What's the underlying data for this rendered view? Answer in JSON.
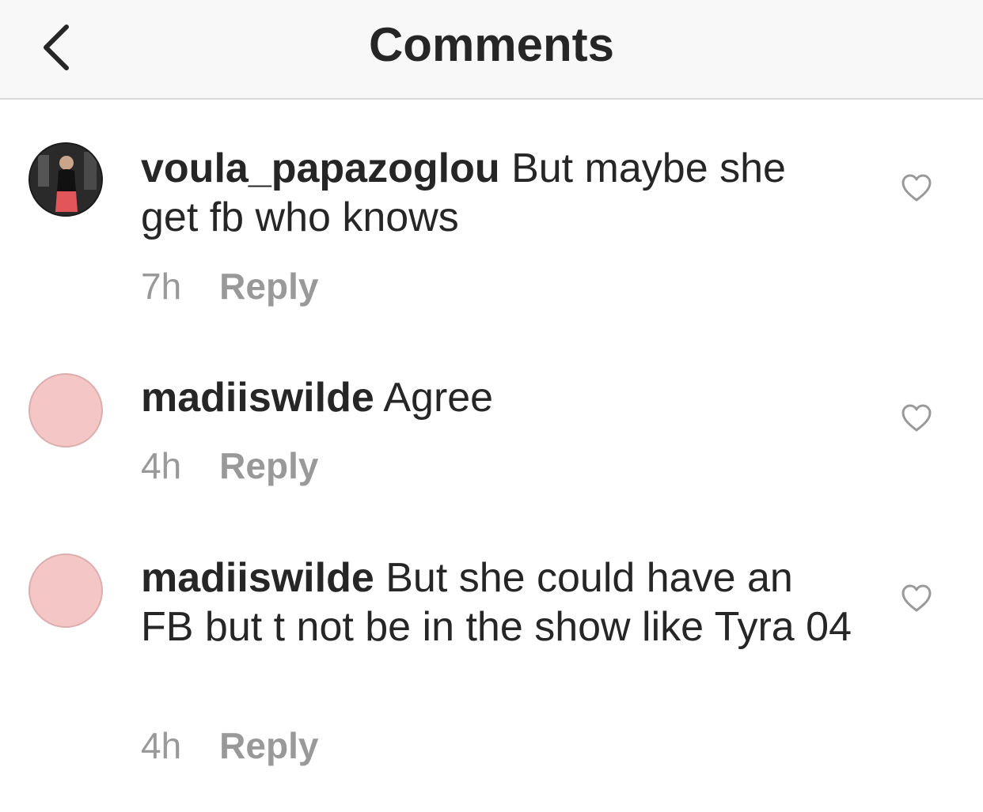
{
  "header": {
    "title": "Comments",
    "back_icon": "chevron-left-icon"
  },
  "comments": [
    {
      "username": "voula_papazoglou",
      "text": "But maybe she get fb who knows",
      "time": "7h",
      "reply_label": "Reply",
      "avatar": "profile-photo",
      "like_icon": "heart-outline-icon"
    },
    {
      "username": "madiiswilde",
      "text": "Agree",
      "time": "4h",
      "reply_label": "Reply",
      "avatar": "blank-pink",
      "like_icon": "heart-outline-icon"
    },
    {
      "username": "madiiswilde",
      "text": "But she could have an FB but t not be in the show like Tyra 04",
      "time": "4h",
      "reply_label": "Reply",
      "avatar": "blank-pink",
      "like_icon": "heart-outline-icon"
    }
  ],
  "colors": {
    "header_bg": "#f8f8f8",
    "text": "#262626",
    "secondary_text": "#999999",
    "avatar_blank": "#f4c6c6"
  }
}
